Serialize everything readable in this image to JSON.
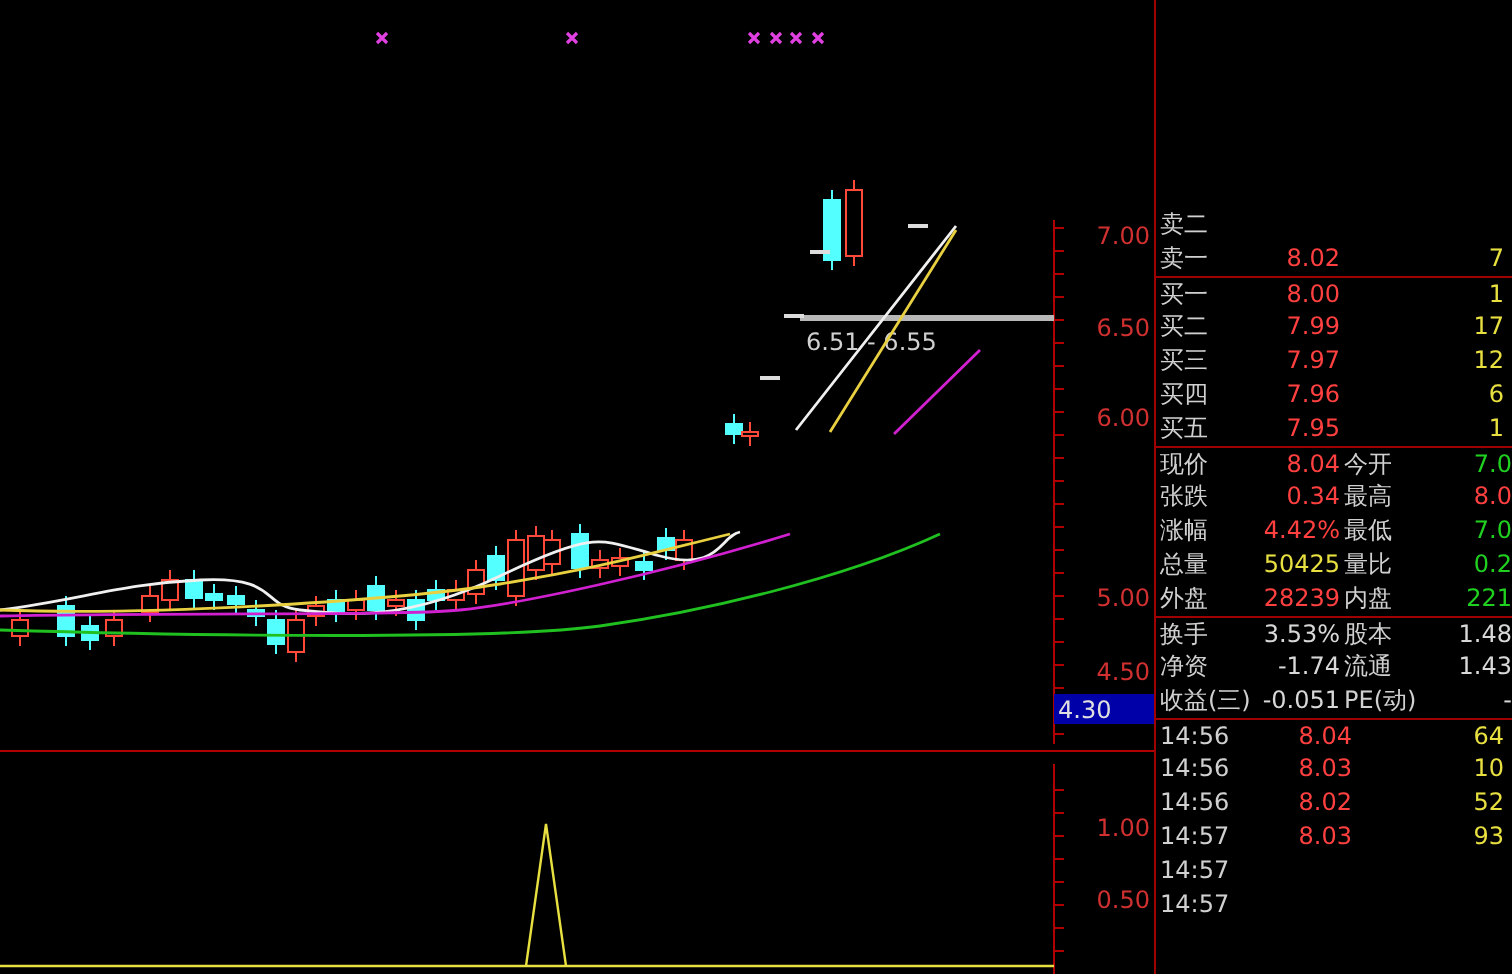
{
  "chart": {
    "price_labels": [
      "7.00",
      "6.50",
      "6.00",
      "5.00",
      "4.50"
    ],
    "current_price": "4.30",
    "range_label": "6.51 - 6.55",
    "indicator_labels": [
      "1.00",
      "0.50"
    ]
  },
  "sell_orders": [
    {
      "label": "卖二"
    },
    {
      "label": "卖一",
      "price": "8.02",
      "volume": "7"
    }
  ],
  "buy_orders": [
    {
      "label": "买一",
      "price": "8.00",
      "volume": "1"
    },
    {
      "label": "买二",
      "price": "7.99",
      "volume": "17"
    },
    {
      "label": "买三",
      "price": "7.97",
      "volume": "12"
    },
    {
      "label": "买四",
      "price": "7.96",
      "volume": "6"
    },
    {
      "label": "买五",
      "price": "7.95",
      "volume": "1"
    }
  ],
  "quote_stats": [
    {
      "label": "现价",
      "value": "8.04",
      "color": "#ff4040"
    },
    {
      "label": "今开",
      "value": "7.0",
      "color": "#20d020"
    },
    {
      "label": "张跌",
      "value": "0.34",
      "color": "#ff4040"
    },
    {
      "label": "最高",
      "value": "8.0",
      "color": "#ff4040"
    },
    {
      "label": "涨幅",
      "value": "4.42%",
      "color": "#ff4040"
    },
    {
      "label": "最低",
      "value": "7.0",
      "color": "#20d020"
    },
    {
      "label": "总量",
      "value": "50425",
      "color": "#e8e040"
    },
    {
      "label": "量比",
      "value": "0.2",
      "color": "#20d020"
    },
    {
      "label": "外盘",
      "value": "28239",
      "color": "#ff4040"
    },
    {
      "label": "内盘",
      "value": "221",
      "color": "#20d020"
    }
  ],
  "share_stats": [
    {
      "label": "换手",
      "value": "3.53%"
    },
    {
      "label": "股本",
      "value": "1.48"
    },
    {
      "label": "净资",
      "value": "-1.74"
    },
    {
      "label": "流通",
      "value": "1.43"
    },
    {
      "label": "收益(三)",
      "value": "-0.051"
    },
    {
      "label": "PE(动)",
      "value": "-"
    }
  ],
  "trades": [
    {
      "time": "14:56",
      "price": "8.04",
      "volume": "64"
    },
    {
      "time": "14:56",
      "price": "8.03",
      "volume": "10"
    },
    {
      "time": "14:56",
      "price": "8.02",
      "volume": "52"
    },
    {
      "time": "14:57",
      "price": "8.03",
      "volume": "93"
    },
    {
      "time": "14:57"
    },
    {
      "time": "14:57"
    }
  ]
}
